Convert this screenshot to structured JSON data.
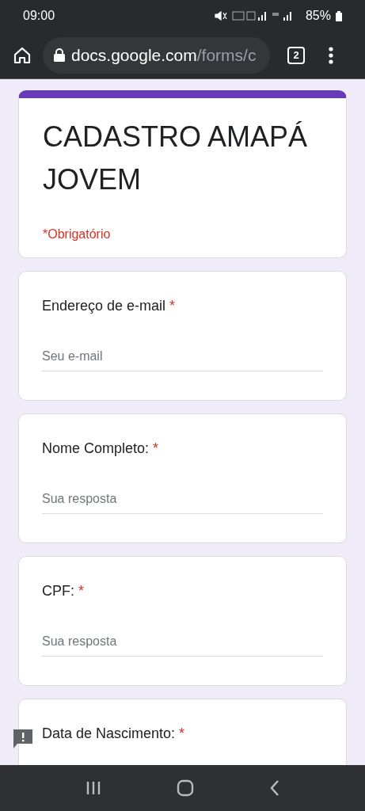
{
  "status_bar": {
    "time": "09:00",
    "battery": "85%"
  },
  "browser": {
    "domain": "docs.google.com",
    "path": "/forms/c",
    "tab_count": "2"
  },
  "form": {
    "title": "CADASTRO AMAPÁ JOVEM",
    "required_note": "*Obrigatório"
  },
  "questions": [
    {
      "label": "Endereço de e-mail",
      "required_mark": "*",
      "placeholder": "Seu e-mail"
    },
    {
      "label": "Nome Completo:",
      "required_mark": "*",
      "placeholder": "Sua resposta"
    },
    {
      "label": "CPF:",
      "required_mark": "*",
      "placeholder": "Sua resposta"
    },
    {
      "label": "Data de Nascimento:",
      "required_mark": "*"
    }
  ]
}
